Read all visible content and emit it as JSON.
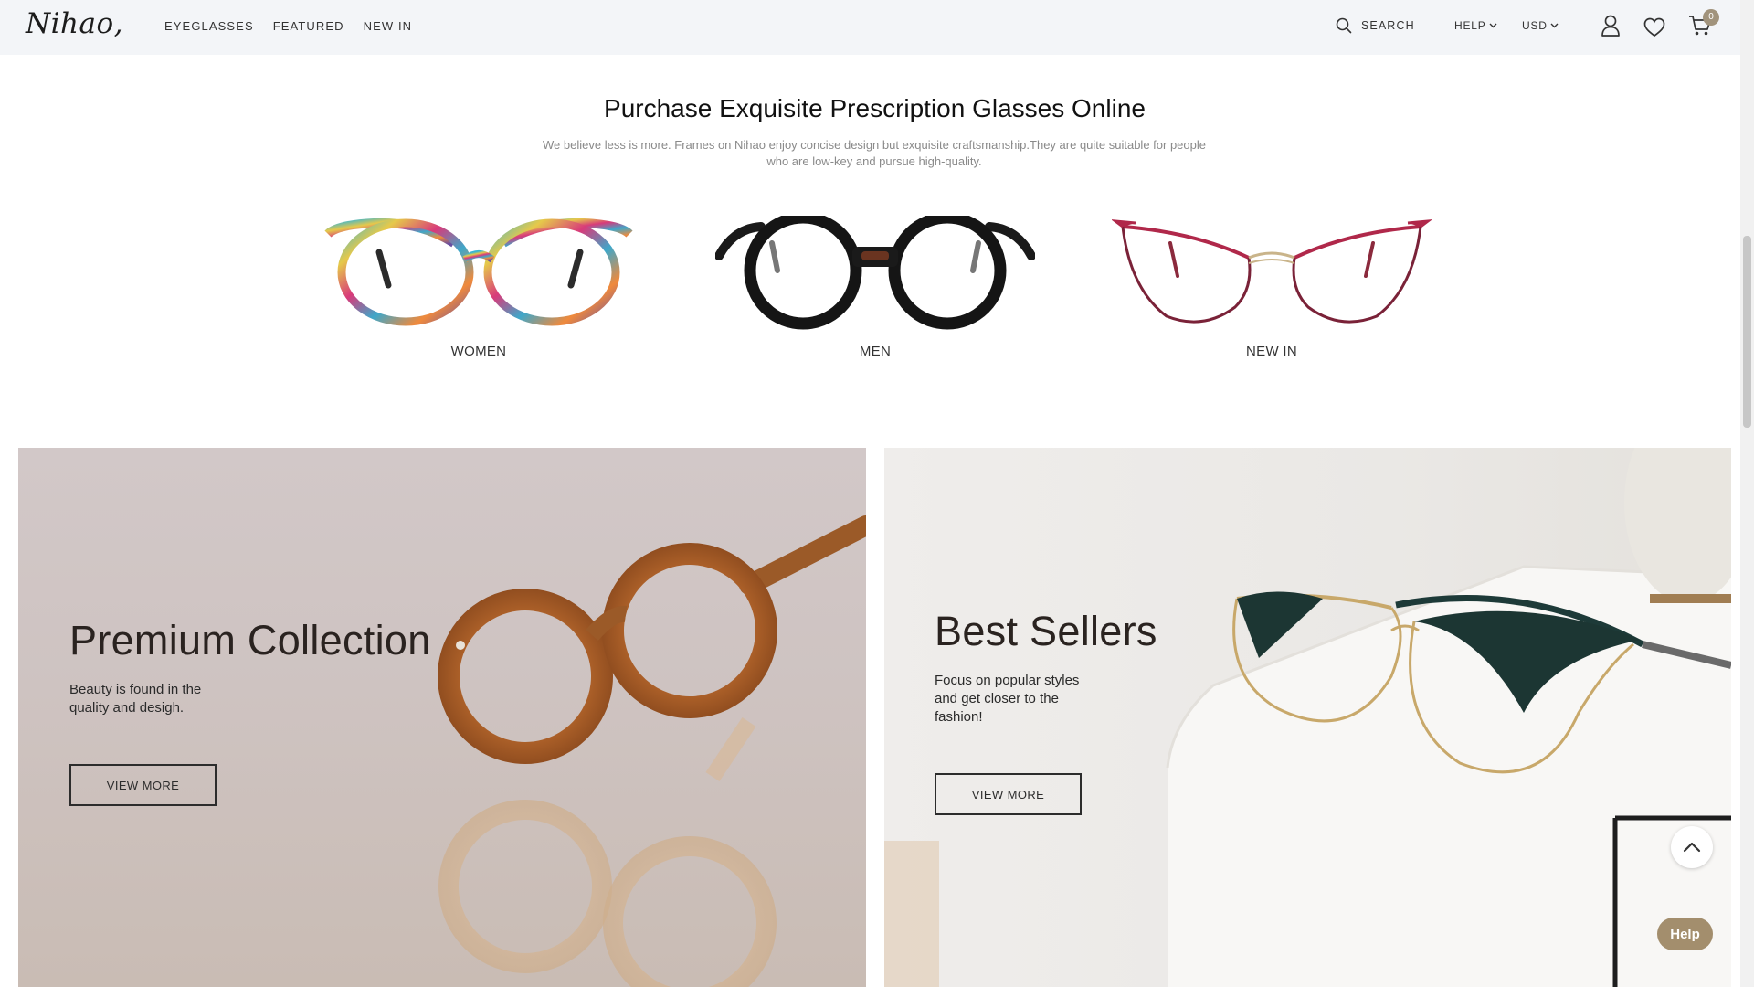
{
  "header": {
    "logo": "Nihao,",
    "nav": [
      "EYEGLASSES",
      "FEATURED",
      "NEW IN"
    ],
    "search_label": "SEARCH",
    "help_label": "HELP",
    "currency_label": "USD",
    "cart_count": "0"
  },
  "intro": {
    "title": "Purchase Exquisite Prescription Glasses Online",
    "subtitle": "We believe less is more. Frames on Nihao enjoy concise design but exquisite craftsmanship.They are quite suitable for people who are low-key and pursue high-quality.",
    "categories": [
      "WOMEN",
      "MEN",
      "NEW IN"
    ]
  },
  "banners": [
    {
      "title": "Premium Collection",
      "text": "Beauty is found in the quality and desigh.",
      "button": "VIEW MORE"
    },
    {
      "title": "Best Sellers",
      "text": "Focus on popular styles and get closer to the fashion!",
      "button": "VIEW MORE"
    }
  ],
  "floating": {
    "help_button": "Help"
  },
  "colors": {
    "header_bg": "#f3f5f8",
    "accent": "#a38e6d",
    "badge": "#a1937c"
  }
}
